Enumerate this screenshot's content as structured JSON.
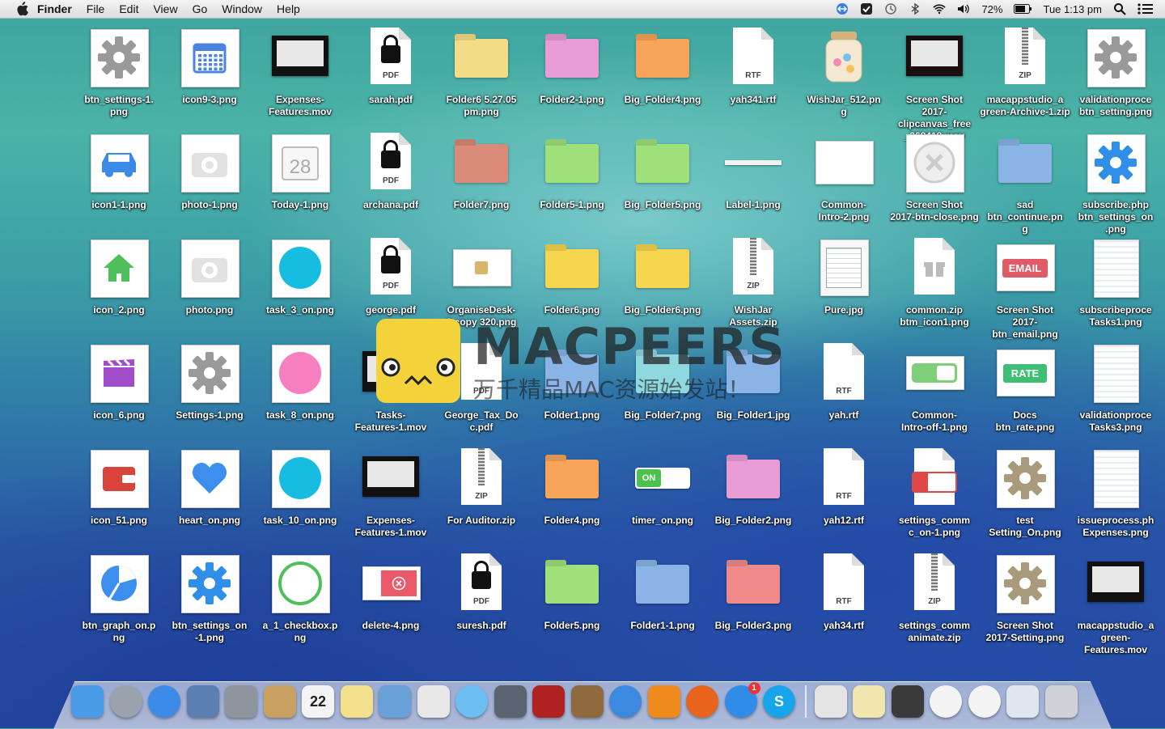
{
  "menubar": {
    "app_name": "Finder",
    "menus": [
      "File",
      "Edit",
      "View",
      "Go",
      "Window",
      "Help"
    ],
    "battery_percent": "72%",
    "clock": "Tue 1:13 pm",
    "status_icons": [
      "teamviewer-icon",
      "dashboard-icon",
      "time-machine-icon",
      "bluetooth-icon",
      "wifi-icon",
      "volume-icon",
      "battery-icon",
      "spotlight-icon",
      "notification-center-icon"
    ]
  },
  "desktop": {
    "items": [
      {
        "label": "btn_settings-1.\npng",
        "icon": "gear-icon",
        "kind": "gear"
      },
      {
        "label": "icon9-3.png",
        "icon": "calendar-icon",
        "kind": "calendar"
      },
      {
        "label": "Expenses-\nFeatures.mov",
        "icon": "movie-icon",
        "kind": "screen"
      },
      {
        "label": "sarah.pdf",
        "icon": "pdf-icon",
        "kind": "pdf"
      },
      {
        "label": "Folder6 5.27.05\npm.png",
        "icon": "folder-icon",
        "kind": "folder",
        "color": "#f3dc86"
      },
      {
        "label": "Folder2-1.png",
        "icon": "folder-icon",
        "kind": "folder",
        "color": "#e99bd6"
      },
      {
        "label": "Big_Folder4.png",
        "icon": "folder-icon",
        "kind": "folder",
        "color": "#f7a35a"
      },
      {
        "label": "yah341.rtf",
        "icon": "rtf-icon",
        "kind": "rtf"
      },
      {
        "label": "WishJar_512.pn\ng",
        "icon": "jar-icon",
        "kind": "jar"
      },
      {
        "label": "Screen Shot\n2017-clipcanvas_free\n_268418.mov",
        "icon": "movie-icon",
        "kind": "bokeh"
      },
      {
        "label": "macappstudio_a\ngreen-Archive-1.zip",
        "icon": "zip-icon",
        "kind": "zip"
      },
      {
        "label": "validationproce\nbtn_setting.png",
        "icon": "gear-icon",
        "kind": "gear"
      },
      {
        "label": "icon1-1.png",
        "icon": "car-icon",
        "kind": "car"
      },
      {
        "label": "photo-1.png",
        "icon": "camera-icon",
        "kind": "camera"
      },
      {
        "label": "Today-1.png",
        "icon": "calendar-icon",
        "kind": "today"
      },
      {
        "label": "archana.pdf",
        "icon": "pdf-icon",
        "kind": "pdf"
      },
      {
        "label": "Folder7.png",
        "icon": "folder-icon",
        "kind": "folder",
        "color": "#d98a78"
      },
      {
        "label": "Folder5-1.png",
        "icon": "folder-icon",
        "kind": "folder",
        "color": "#9fe07a"
      },
      {
        "label": "Big_Folder5.png",
        "icon": "folder-icon",
        "kind": "folder",
        "color": "#9fe07a"
      },
      {
        "label": "Label-1.png",
        "icon": "label-icon",
        "kind": "label"
      },
      {
        "label": "Common-\nIntro-2.png",
        "icon": "image-icon",
        "kind": "blank"
      },
      {
        "label": "Screen Shot\n2017-btn-close.png",
        "icon": "close-icon",
        "kind": "closecircle"
      },
      {
        "label": "sad\nbtn_continue.pn\ng",
        "icon": "folder-icon",
        "kind": "folder",
        "color": "#8ab4e6"
      },
      {
        "label": "subscribe.php\nbtn_settings_on\n.png",
        "icon": "gear-icon",
        "kind": "gearblue"
      },
      {
        "label": "icon_2.png",
        "icon": "home-icon",
        "kind": "home"
      },
      {
        "label": "photo.png",
        "icon": "camera-icon",
        "kind": "camera"
      },
      {
        "label": "task_3_on.png",
        "icon": "circle-icon",
        "kind": "circle",
        "color": "#17bde0"
      },
      {
        "label": "george.pdf",
        "icon": "pdf-icon",
        "kind": "pdf"
      },
      {
        "label": "OrganiseDesk-\n3 copy 320.png",
        "icon": "image-icon",
        "kind": "screenwhite"
      },
      {
        "label": "Folder6.png",
        "icon": "folder-icon",
        "kind": "folder",
        "color": "#f7d54f"
      },
      {
        "label": "Big_Folder6.png",
        "icon": "folder-icon",
        "kind": "folder",
        "color": "#f7d54f"
      },
      {
        "label": "WishJar\nAssets.zip",
        "icon": "zip-icon",
        "kind": "zip"
      },
      {
        "label": "Pure.jpg",
        "icon": "document-icon",
        "kind": "pure"
      },
      {
        "label": "common.zip\nbtm_icon1.png",
        "icon": "gift-icon",
        "kind": "gift"
      },
      {
        "label": "Screen Shot\n2017-btn_email.png",
        "icon": "email-icon",
        "kind": "email"
      },
      {
        "label": "subscribeproce\nTasks1.png",
        "icon": "document-icon",
        "kind": "list"
      },
      {
        "label": "icon_6.png",
        "icon": "clapper-icon",
        "kind": "clapper"
      },
      {
        "label": "Settings-1.png",
        "icon": "gear-icon",
        "kind": "gear"
      },
      {
        "label": "task_8_on.png",
        "icon": "circle-icon",
        "kind": "circle",
        "color": "#f77fc0"
      },
      {
        "label": "Tasks-\nFeatures-1.mov",
        "icon": "movie-icon",
        "kind": "screen"
      },
      {
        "label": "George_Tax_Do\nc.pdf",
        "icon": "pdf-icon",
        "kind": "pdfplain"
      },
      {
        "label": "Folder1.png",
        "icon": "folder-icon",
        "kind": "folder",
        "color": "#8ab4e6"
      },
      {
        "label": "Big_Folder7.png",
        "icon": "folder-icon",
        "kind": "folder",
        "color": "#8fd8e0"
      },
      {
        "label": "Big_Folder1.jpg",
        "icon": "folder-icon",
        "kind": "folder",
        "color": "#8ab4e6"
      },
      {
        "label": "yah.rtf",
        "icon": "rtf-icon",
        "kind": "rtf"
      },
      {
        "label": "Common-\nIntro-off-1.png",
        "icon": "toggle-icon",
        "kind": "toggleoff"
      },
      {
        "label": "Docs\nbtn_rate.png",
        "icon": "rate-icon",
        "kind": "rate"
      },
      {
        "label": "validationproce\nTasks3.png",
        "icon": "document-icon",
        "kind": "list"
      },
      {
        "label": "icon_51.png",
        "icon": "wallet-icon",
        "kind": "wallet"
      },
      {
        "label": "heart_on.png",
        "icon": "heart-icon",
        "kind": "heart"
      },
      {
        "label": "task_10_on.png",
        "icon": "circle-icon",
        "kind": "circle",
        "color": "#17bde0"
      },
      {
        "label": "Expenses-\nFeatures-1.mov",
        "icon": "movie-icon",
        "kind": "screen"
      },
      {
        "label": "For Auditor.zip",
        "icon": "zip-icon",
        "kind": "zip"
      },
      {
        "label": "Folder4.png",
        "icon": "folder-icon",
        "kind": "folder",
        "color": "#f7a35a"
      },
      {
        "label": "timer_on.png",
        "icon": "toggle-icon",
        "kind": "toggleon"
      },
      {
        "label": "Big_Folder2.png",
        "icon": "folder-icon",
        "kind": "folder",
        "color": "#e99bd6"
      },
      {
        "label": "yah12.rtf",
        "icon": "rtf-icon",
        "kind": "rtf"
      },
      {
        "label": "settings_comm\nc_on-1.png",
        "icon": "lock-toggle-icon",
        "kind": "locktoggle"
      },
      {
        "label": "test\nSetting_On.png",
        "icon": "gear-icon",
        "kind": "geargold"
      },
      {
        "label": "issueprocess.ph\nExpenses.png",
        "icon": "document-icon",
        "kind": "list"
      },
      {
        "label": "btn_graph_on.p\nng",
        "icon": "pie-chart-icon",
        "kind": "graph"
      },
      {
        "label": "btn_settings_on\n-1.png",
        "icon": "gear-icon",
        "kind": "gearblue"
      },
      {
        "label": "a_1_checkbox.p\nng",
        "icon": "checkbox-icon",
        "kind": "ring"
      },
      {
        "label": "delete-4.png",
        "icon": "delete-icon",
        "kind": "delete"
      },
      {
        "label": "suresh.pdf",
        "icon": "pdf-icon",
        "kind": "pdf"
      },
      {
        "label": "Folder5.png",
        "icon": "folder-icon",
        "kind": "folder",
        "color": "#9fe07a"
      },
      {
        "label": "Folder1-1.png",
        "icon": "folder-icon",
        "kind": "folder",
        "color": "#8ab4e6"
      },
      {
        "label": "Big_Folder3.png",
        "icon": "folder-icon",
        "kind": "folder",
        "color": "#f08a8a"
      },
      {
        "label": "yah34.rtf",
        "icon": "rtf-icon",
        "kind": "rtf"
      },
      {
        "label": "settings_comm\nanimate.zip",
        "icon": "zip-icon",
        "kind": "zip"
      },
      {
        "label": "Screen Shot\n2017-Setting.png",
        "icon": "gear-icon",
        "kind": "geargold"
      },
      {
        "label": "macappstudio_a\ngreen-Features.mov",
        "icon": "movie-icon",
        "kind": "screen"
      }
    ]
  },
  "watermark": {
    "brand": "MACPEERS",
    "subtitle": "万千精品MAC资源始发站！"
  },
  "dock": {
    "apps": [
      {
        "name": "finder-icon",
        "color": "#4a9be8"
      },
      {
        "name": "launchpad-icon",
        "color": "#9aa3ad"
      },
      {
        "name": "safari-icon",
        "color": "#3d8be8"
      },
      {
        "name": "preview-icon",
        "color": "#5b7fb0"
      },
      {
        "name": "system-preferences-icon",
        "color": "#8e959c"
      },
      {
        "name": "contacts-icon",
        "color": "#c9a060"
      },
      {
        "name": "calendar-icon",
        "color": "#f4f4f4",
        "text": "22"
      },
      {
        "name": "notes-icon",
        "color": "#f2e08a"
      },
      {
        "name": "xcode-icon",
        "color": "#6aa0d8"
      },
      {
        "name": "textedit-icon",
        "color": "#e8e8e8"
      },
      {
        "name": "messages-icon",
        "color": "#6cbff2"
      },
      {
        "name": "facetime-icon",
        "color": "#5a6470"
      },
      {
        "name": "photo-booth-icon",
        "color": "#b02222"
      },
      {
        "name": "iphoto-icon",
        "color": "#8f6a3e"
      },
      {
        "name": "itunes-icon",
        "color": "#3b8ae0"
      },
      {
        "name": "ibooks-icon",
        "color": "#f08a1c"
      },
      {
        "name": "firefox-icon",
        "color": "#e8641c"
      },
      {
        "name": "app-store-icon",
        "color": "#2f8ce8",
        "badge": "1"
      },
      {
        "name": "skype-icon",
        "color": "#16a5ea",
        "text": "S"
      }
    ],
    "docs": [
      {
        "name": "document-stack-icon",
        "color": "#e4e4e4"
      },
      {
        "name": "notes-stack-icon",
        "color": "#f1e6b0"
      },
      {
        "name": "screenshot-stack-icon",
        "color": "#3a3a3a"
      },
      {
        "name": "safari-window-icon",
        "color": "#f4f4f4"
      },
      {
        "name": "firefox-window-icon",
        "color": "#f4f4f4"
      },
      {
        "name": "screenshot-window-icon",
        "color": "#dfe6ee"
      },
      {
        "name": "trash-icon",
        "color": "#cfd3d8"
      }
    ]
  },
  "colors": {
    "label_text": "#ffffff",
    "menubar_bg": "#e6e6e6"
  }
}
